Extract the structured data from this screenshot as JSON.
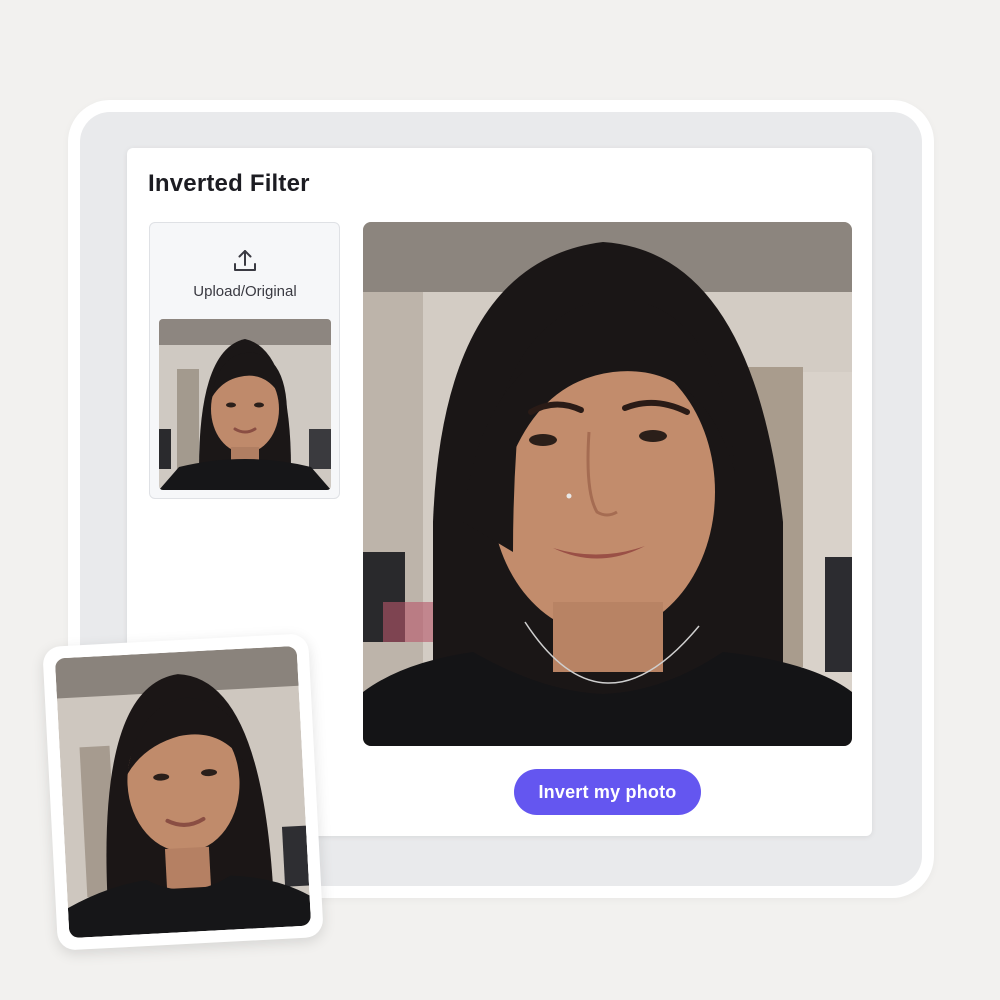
{
  "app": {
    "title": "Inverted Filter"
  },
  "upload": {
    "label": "Upload/Original",
    "icon": "upload-icon"
  },
  "actions": {
    "invert_label": "Invert my photo"
  },
  "colors": {
    "accent": "#6456f0",
    "background": "#f2f1ef",
    "frame": "#e9eaec"
  }
}
